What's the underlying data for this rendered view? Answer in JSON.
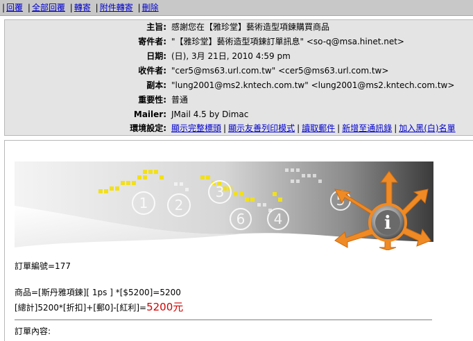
{
  "toolbar": {
    "items": [
      "回覆",
      "全部回覆",
      "轉寄",
      "附件轉寄",
      "刪除"
    ]
  },
  "headers": {
    "subject_label": "主旨:",
    "subject": "感謝您在【雅珍堂】藝術造型項鍊購買商品",
    "from_label": "寄件者:",
    "from": "\"【雅珍堂】藝術造型項鍊訂單訊息\" <so-q@msa.hinet.net>",
    "date_label": "日期:",
    "date": "(日), 3月 21日, 2010 4:59 pm",
    "to_label": "收件者:",
    "to": "\"cer5@ms63.url.com.tw\" <cer5@ms63.url.com.tw>",
    "cc_label": "副本:",
    "cc": "\"lung2001@ms2.kntech.com.tw\" <lung2001@ms2.kntech.com.tw>",
    "priority_label": "重要性:",
    "priority": "普通",
    "mailer_label": "Mailer:",
    "mailer": "JMail 4.5 by Dimac",
    "options_label": "環境設定:",
    "options": [
      "顯示完整標頭",
      "顯示友善列印模式",
      "讀取郵件",
      "新增至通訊錄",
      "加入黑(白)名單"
    ]
  },
  "body": {
    "order_no": "訂單編號=177",
    "item_line": "商品=[斯丹雅項鍊][ 1ps ] *[$5200]=5200",
    "total_prefix": "[總計]5200*[折扣]+[郵0]-[紅利]=",
    "total_amount": "5200元",
    "content_label": "訂單內容:",
    "banner_numbers": [
      "1",
      "2",
      "3",
      "4",
      "5",
      "6"
    ]
  },
  "colors": {
    "link": "#0000cc",
    "toolbar_bg": "#c8c8c8",
    "header_bg": "#e4e4e4",
    "total_red": "#d00000",
    "banner_yellow": "#f2e01a",
    "banner_orange": "#f08a24"
  }
}
